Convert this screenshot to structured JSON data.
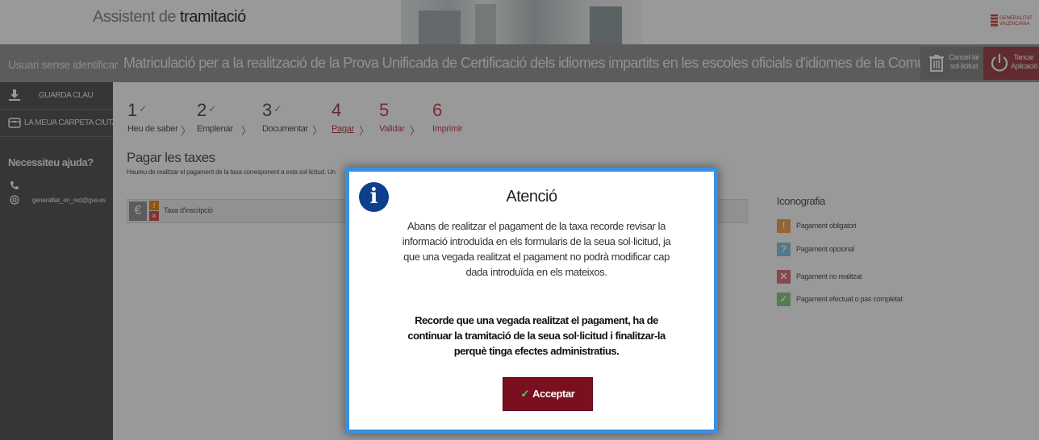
{
  "header": {
    "title_prefix": "Assistent de ",
    "title_strong": "tramitació",
    "logo_text": "GENERALITAT VALENCIANA"
  },
  "titlebar": {
    "user": "Usuari sense identificar",
    "procedure": "Matriculació per a la realització de la Prova Unificada de Certificació dels idiomes impartits en les escoles oficials d'idiomes de la Comunitat Valenciana",
    "cancel_label": "Cancel·lar sol·licitud",
    "close_label": "Tancar Aplicació"
  },
  "sidebar": {
    "items": [
      {
        "label": "GUARDA CLAU",
        "icon": "download-icon"
      },
      {
        "label": "LA MEUA CARPETA CIUTADANA",
        "icon": "folder-icon"
      }
    ],
    "help_title": "Necessiteu ajuda?",
    "email": "generalitat_en_red@gva.es"
  },
  "steps": [
    {
      "num": "1",
      "label": "Heu de saber",
      "done": true
    },
    {
      "num": "2",
      "label": "Emplenar",
      "done": true
    },
    {
      "num": "3",
      "label": "Documentar",
      "done": true
    },
    {
      "num": "4",
      "label": "Pagar",
      "done": false,
      "active": true
    },
    {
      "num": "5",
      "label": "Validar",
      "done": false
    },
    {
      "num": "6",
      "label": "Imprimir",
      "done": false
    }
  ],
  "section": {
    "title": "Pagar les taxes",
    "subtitle": "Haureu de realitzar el pagament de la taxa corresponent a esta sol·licitud. Un",
    "tax_label": "Taxa d'inscripció"
  },
  "legend": {
    "title": "Iconografia",
    "items": [
      {
        "symbol": "!",
        "label": "Pagament obligatori",
        "color": "#f5a65b"
      },
      {
        "symbol": "?",
        "label": "Pagament opcional",
        "color": "#8fc9e8"
      },
      {
        "symbol": "✕",
        "label": "Pagament no realitzat",
        "color": "#e07b78"
      },
      {
        "symbol": "✓",
        "label": "Pagament efectuat o pas completat",
        "color": "#8ccf8c"
      }
    ]
  },
  "modal": {
    "title": "Atenció",
    "body": "Abans de realitzar el pagament de la taxa recorde revisar la informació introduïda en els formularis de la seua sol·licitud, ja que una vegada realitzat el pagament no podrà modificar cap dada introduïda en els mateixos.",
    "body_bold": "Recorde que una vegada realitzat el pagament, ha de continuar la tramitació de la seua sol·licitud i finalitzar-la perquè tinga efectes administratius.",
    "accept_label": "Acceptar"
  },
  "colors": {
    "accent": "#7a0f1f",
    "modal_border": "#3a8fe0",
    "info_icon": "#0e3f8c"
  }
}
